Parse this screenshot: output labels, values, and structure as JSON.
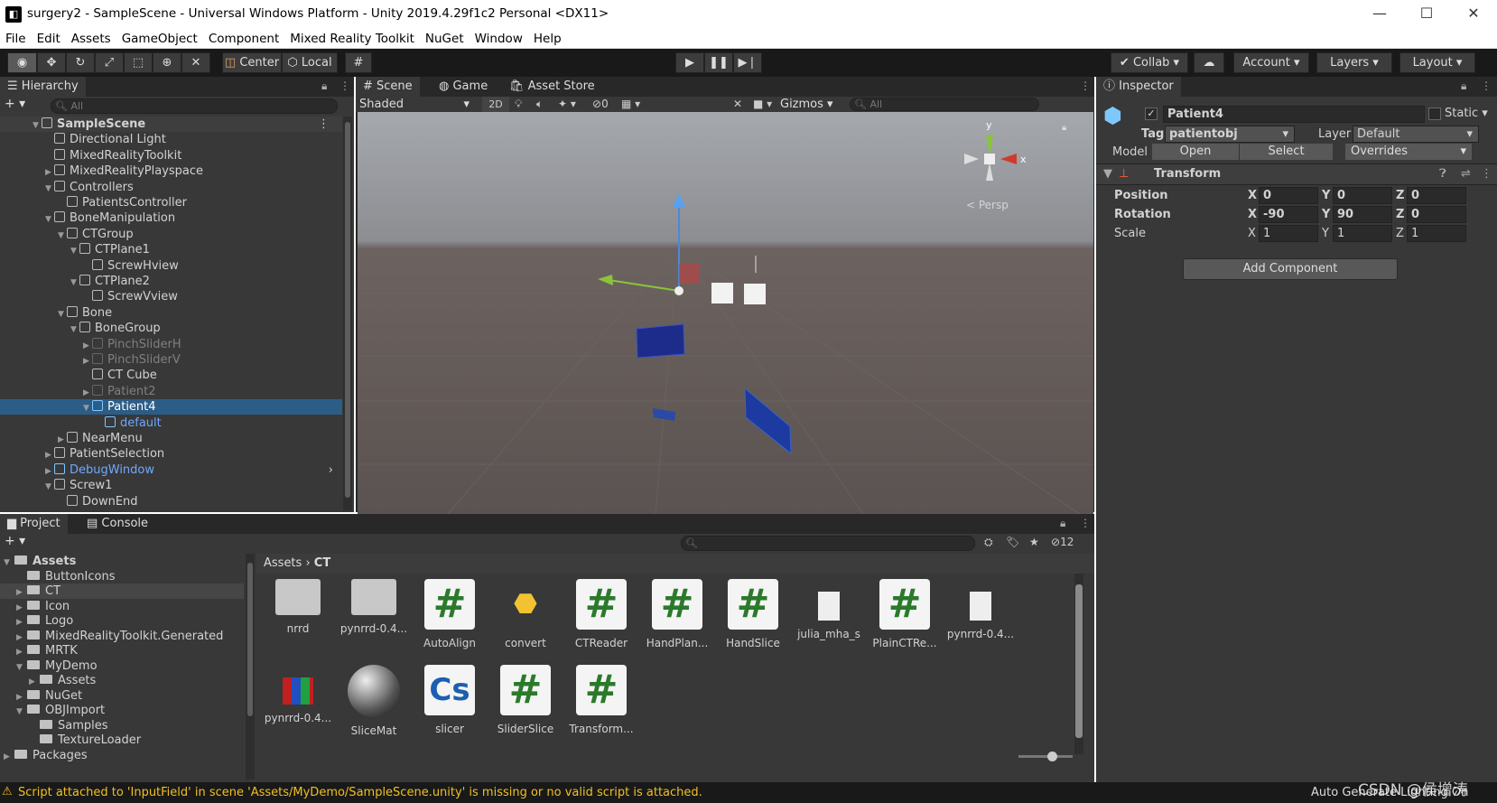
{
  "window": {
    "title": "surgery2 - SampleScene - Universal Windows Platform - Unity 2019.4.29f1c2 Personal <DX11>",
    "minimize": "—",
    "maximize": "☐",
    "close": "✕"
  },
  "menu": [
    "File",
    "Edit",
    "Assets",
    "GameObject",
    "Component",
    "Mixed Reality Toolkit",
    "NuGet",
    "Window",
    "Help"
  ],
  "toolbar": {
    "center": "Center",
    "local": "Local",
    "collab": "Collab",
    "account": "Account",
    "layers": "Layers",
    "layout": "Layout"
  },
  "hierarchy": {
    "tab": "Hierarchy",
    "search_placeholder": "All",
    "rows": [
      {
        "label": "SampleScene",
        "indent": 0,
        "arrow": "▼",
        "style": "scene"
      },
      {
        "label": "Directional Light",
        "indent": 1,
        "arrow": "",
        "style": ""
      },
      {
        "label": "MixedRealityToolkit",
        "indent": 1,
        "arrow": "",
        "style": ""
      },
      {
        "label": "MixedRealityPlayspace",
        "indent": 1,
        "arrow": "▶",
        "style": ""
      },
      {
        "label": "Controllers",
        "indent": 1,
        "arrow": "▼",
        "style": ""
      },
      {
        "label": "PatientsController",
        "indent": 2,
        "arrow": "",
        "style": ""
      },
      {
        "label": "BoneManipulation",
        "indent": 1,
        "arrow": "▼",
        "style": ""
      },
      {
        "label": "CTGroup",
        "indent": 2,
        "arrow": "▼",
        "style": ""
      },
      {
        "label": "CTPlane1",
        "indent": 3,
        "arrow": "▼",
        "style": ""
      },
      {
        "label": "ScrewHview",
        "indent": 4,
        "arrow": "",
        "style": ""
      },
      {
        "label": "CTPlane2",
        "indent": 3,
        "arrow": "▼",
        "style": ""
      },
      {
        "label": "ScrewVview",
        "indent": 4,
        "arrow": "",
        "style": ""
      },
      {
        "label": "Bone",
        "indent": 2,
        "arrow": "▼",
        "style": ""
      },
      {
        "label": "BoneGroup",
        "indent": 3,
        "arrow": "▼",
        "style": ""
      },
      {
        "label": "PinchSliderH",
        "indent": 4,
        "arrow": "▶",
        "style": "dim"
      },
      {
        "label": "PinchSliderV",
        "indent": 4,
        "arrow": "▶",
        "style": "dim"
      },
      {
        "label": "CT Cube",
        "indent": 4,
        "arrow": "",
        "style": ""
      },
      {
        "label": "Patient2",
        "indent": 4,
        "arrow": "▶",
        "style": "dim"
      },
      {
        "label": "Patient4",
        "indent": 4,
        "arrow": "▼",
        "style": "sel"
      },
      {
        "label": "default",
        "indent": 5,
        "arrow": "",
        "style": "blue"
      },
      {
        "label": "NearMenu",
        "indent": 2,
        "arrow": "▶",
        "style": ""
      },
      {
        "label": "PatientSelection",
        "indent": 1,
        "arrow": "▶",
        "style": ""
      },
      {
        "label": "DebugWindow",
        "indent": 1,
        "arrow": "▶",
        "style": "blue"
      },
      {
        "label": "Screw1",
        "indent": 1,
        "arrow": "▼",
        "style": ""
      },
      {
        "label": "DownEnd",
        "indent": 2,
        "arrow": "",
        "style": ""
      }
    ]
  },
  "scene": {
    "tab_scene": "Scene",
    "tab_game": "Game",
    "tab_store": "Asset Store",
    "shading": "Shaded",
    "mode_2d": "2D",
    "hidden_count": "0",
    "gizmos": "Gizmos",
    "search_placeholder": "All",
    "axis_y": "y",
    "axis_x": "x",
    "persp": "< Persp"
  },
  "inspector": {
    "tab": "Inspector",
    "name": "Patient4",
    "static": "Static",
    "tag_label": "Tag",
    "tag_value": "patientobj",
    "layer_label": "Layer",
    "layer_value": "Default",
    "model_label": "Model",
    "open": "Open",
    "select": "Select",
    "overrides": "Overrides",
    "component": "Transform",
    "position": {
      "label": "Position",
      "x": "0",
      "y": "0",
      "z": "0"
    },
    "rotation": {
      "label": "Rotation",
      "x": "-90",
      "y": "90",
      "z": "0"
    },
    "scale": {
      "label": "Scale",
      "x": "1",
      "y": "1",
      "z": "1"
    },
    "add_component": "Add Component"
  },
  "project": {
    "tab_project": "Project",
    "tab_console": "Console",
    "hidden_count": "12",
    "breadcrumb": [
      "Assets",
      "CT"
    ],
    "tree": [
      {
        "label": "Assets",
        "indent": 0,
        "arrow": "▼",
        "bold": true
      },
      {
        "label": "ButtonIcons",
        "indent": 1,
        "arrow": ""
      },
      {
        "label": "CT",
        "indent": 1,
        "arrow": "▶",
        "sel": true
      },
      {
        "label": "Icon",
        "indent": 1,
        "arrow": "▶"
      },
      {
        "label": "Logo",
        "indent": 1,
        "arrow": "▶"
      },
      {
        "label": "MixedRealityToolkit.Generated",
        "indent": 1,
        "arrow": "▶"
      },
      {
        "label": "MRTK",
        "indent": 1,
        "arrow": "▶"
      },
      {
        "label": "MyDemo",
        "indent": 1,
        "arrow": "▼"
      },
      {
        "label": "Assets",
        "indent": 2,
        "arrow": "▶"
      },
      {
        "label": "NuGet",
        "indent": 1,
        "arrow": "▶"
      },
      {
        "label": "OBJImport",
        "indent": 1,
        "arrow": "▼"
      },
      {
        "label": "Samples",
        "indent": 2,
        "arrow": ""
      },
      {
        "label": "TextureLoader",
        "indent": 2,
        "arrow": ""
      },
      {
        "label": "Packages",
        "indent": 0,
        "arrow": "▶"
      }
    ],
    "assets": [
      {
        "label": "nrrd",
        "kind": "folder"
      },
      {
        "label": "pynrrd-0.4...",
        "kind": "folder"
      },
      {
        "label": "AutoAlign",
        "kind": "script"
      },
      {
        "label": "convert",
        "kind": "python"
      },
      {
        "label": "CTReader",
        "kind": "script"
      },
      {
        "label": "HandPlan...",
        "kind": "script"
      },
      {
        "label": "HandSlice",
        "kind": "script"
      },
      {
        "label": "julia_mha_s",
        "kind": "doc"
      },
      {
        "label": "PlainCTRe...",
        "kind": "script"
      },
      {
        "label": "pynrrd-0.4...",
        "kind": "doc"
      },
      {
        "label": "pynrrd-0.4...",
        "kind": "archive"
      },
      {
        "label": "SliceMat",
        "kind": "material"
      },
      {
        "label": "slicer",
        "kind": "cs"
      },
      {
        "label": "SliderSlice",
        "kind": "script"
      },
      {
        "label": "Transform...",
        "kind": "script"
      }
    ],
    "script_glyph": "#",
    "cs_glyph": "Cs"
  },
  "status": {
    "warning": "Script attached to 'InputField' in scene 'Assets/MyDemo/SampleScene.unity' is missing or no valid script is attached.",
    "right": "Auto Generate Lighting On",
    "watermark": "CSDN @侯增涛"
  }
}
